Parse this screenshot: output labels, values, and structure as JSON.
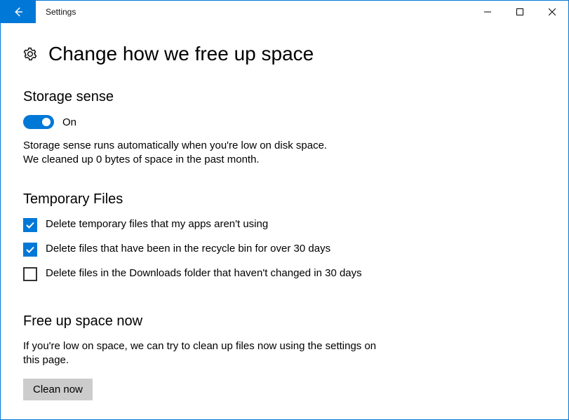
{
  "window": {
    "title": "Settings"
  },
  "page": {
    "title": "Change how we free up space"
  },
  "storage_sense": {
    "heading": "Storage sense",
    "toggle_label": "On",
    "description_line1": "Storage sense runs automatically when you're low on disk space.",
    "description_line2": "We cleaned up 0 bytes of space in the past month."
  },
  "temp_files": {
    "heading": "Temporary Files",
    "items": [
      {
        "label": "Delete temporary files that my apps aren't using",
        "checked": true
      },
      {
        "label": "Delete files that have been in the recycle bin for over 30 days",
        "checked": true
      },
      {
        "label": "Delete files in the Downloads folder that haven't changed in 30 days",
        "checked": false
      }
    ]
  },
  "free_up": {
    "heading": "Free up space now",
    "description": "If you're low on space, we can try to clean up files now using the settings on this page.",
    "button": "Clean now"
  }
}
